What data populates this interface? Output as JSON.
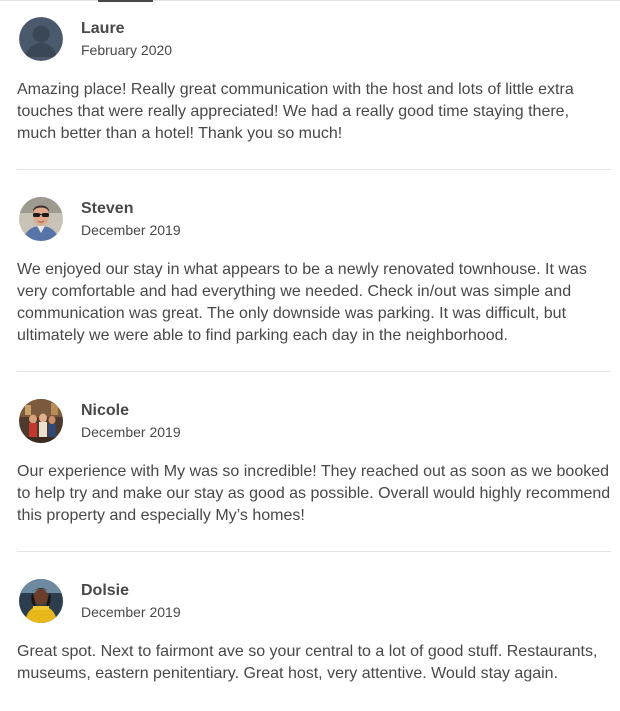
{
  "reviews": [
    {
      "name": "Laure",
      "date": "February 2020",
      "avatar_icon": "default-user-avatar-icon",
      "text": "Amazing place! Really great communication with the host and lots of little extra touches that were really appreciated! We had a really good time staying there, much better than a hotel! Thank you so much!"
    },
    {
      "name": "Steven",
      "date": "December 2019",
      "avatar_icon": "user-photo",
      "text": "We enjoyed our stay in what appears to be a newly renovated townhouse. It was very comfortable and had everything we needed. Check in/out was simple and communication was great. The only downside was parking. It was difficult, but ultimately we were able to find parking each day in the neighborhood."
    },
    {
      "name": "Nicole",
      "date": "December 2019",
      "avatar_icon": "user-photo",
      "text": "Our experience with My was so incredible! They reached out as soon as we booked to help try and make our stay as good as possible. Overall would highly recommend this property and especially My’s homes!"
    },
    {
      "name": "Dolsie",
      "date": "December 2019",
      "avatar_icon": "user-photo",
      "text": "Great spot. Next to fairmont ave so your central to a lot of good stuff. Restaurants, museums, eastern penitentiary. Great host, very attentive. Would stay again."
    }
  ]
}
